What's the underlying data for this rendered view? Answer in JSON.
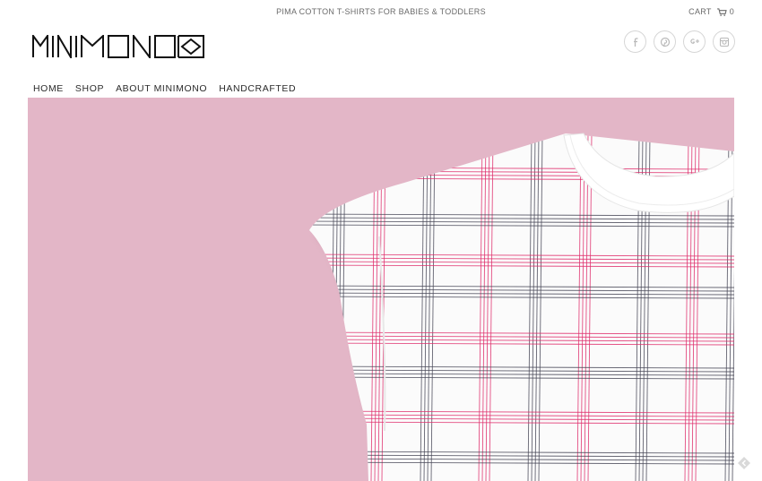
{
  "header": {
    "tagline": "PIMA COTTON T-SHIRTS FOR BABIES & TODDLERS",
    "cart_label": "CART",
    "cart_count": "0",
    "logo_text": "MINIMONO"
  },
  "social": [
    {
      "name": "facebook-icon",
      "glyph": "f"
    },
    {
      "name": "pinterest-icon"
    },
    {
      "name": "google-plus-icon",
      "glyph": "g+"
    },
    {
      "name": "instagram-icon"
    }
  ],
  "nav": {
    "items": [
      {
        "label": "HOME"
      },
      {
        "label": "SHOP"
      },
      {
        "label": "ABOUT MINIMONO"
      },
      {
        "label": "HANDCRAFTED"
      }
    ]
  },
  "hero": {
    "background_color": "#e3b6c7",
    "image_subject": "white t-shirt with pink and grey plaid pattern"
  },
  "colors": {
    "plaid_pink": "#e0306e",
    "plaid_grey": "#4a4a5a"
  }
}
